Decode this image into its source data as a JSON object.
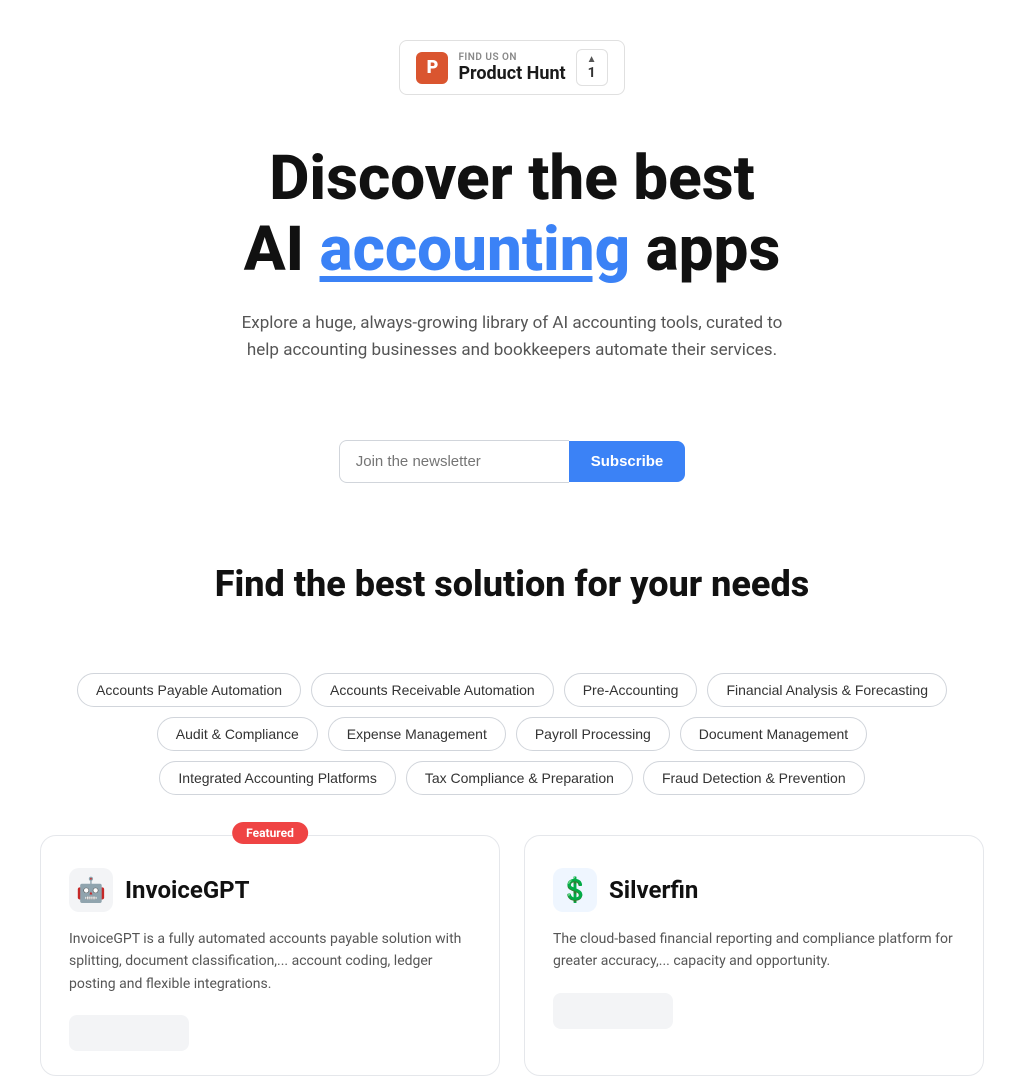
{
  "ph_badge": {
    "find_us": "FIND US ON",
    "name": "Product Hunt",
    "vote_count": "1",
    "arrow": "▲"
  },
  "hero": {
    "line1": "Discover the best",
    "line2_pre": "AI ",
    "line2_accent": "accounting",
    "line2_post": " apps",
    "subtitle": "Explore a huge, always-growing library of AI accounting tools, curated to help accounting businesses and bookkeepers automate their services."
  },
  "newsletter": {
    "placeholder": "Join the newsletter",
    "button_label": "Subscribe"
  },
  "solutions": {
    "title": "Find the best solution for your needs",
    "tags": [
      "Accounts Payable Automation",
      "Accounts Receivable Automation",
      "Pre-Accounting",
      "Financial Analysis & Forecasting",
      "Audit & Compliance",
      "Expense Management",
      "Payroll Processing",
      "Document Management",
      "Integrated Accounting Platforms",
      "Tax Compliance & Preparation",
      "Fraud Detection & Prevention"
    ]
  },
  "cards": [
    {
      "featured": true,
      "featured_label": "Featured",
      "logo_emoji": "🤖",
      "logo_class": "invoice",
      "title": "InvoiceGPT",
      "description": "InvoiceGPT is a fully automated accounts payable solution with splitting, document classification,... account coding, ledger posting and flexible integrations."
    },
    {
      "featured": false,
      "logo_emoji": "💲",
      "logo_class": "silver",
      "title": "Silverfin",
      "description": "The cloud-based financial reporting and compliance platform for greater accuracy,... capacity and opportunity."
    }
  ]
}
